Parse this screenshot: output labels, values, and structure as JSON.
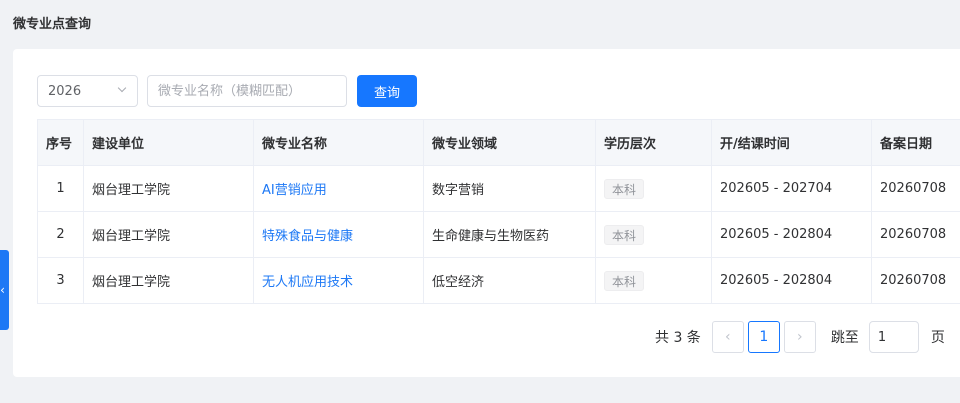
{
  "page": {
    "title": "微专业点查询"
  },
  "side_tab": {
    "icon": "chevron-left-icon",
    "glyph": "‹"
  },
  "filters": {
    "year": {
      "value": "2026"
    },
    "name": {
      "placeholder": "微专业名称（模糊匹配）",
      "value": ""
    },
    "query_label": "查询"
  },
  "table": {
    "columns": [
      "序号",
      "建设单位",
      "微专业名称",
      "微专业领域",
      "学历层次",
      "开/结课时间",
      "备案日期"
    ],
    "rows": [
      {
        "index": "1",
        "unit": "烟台理工学院",
        "name": "AI营销应用",
        "field": "数字营销",
        "level": "本科",
        "period": "202605 - 202704",
        "record_date": "20260708"
      },
      {
        "index": "2",
        "unit": "烟台理工学院",
        "name": "特殊食品与健康",
        "field": "生命健康与生物医药",
        "level": "本科",
        "period": "202605 - 202804",
        "record_date": "20260708"
      },
      {
        "index": "3",
        "unit": "烟台理工学院",
        "name": "无人机应用技术",
        "field": "低空经济",
        "level": "本科",
        "period": "202605 - 202804",
        "record_date": "20260708"
      }
    ]
  },
  "pagination": {
    "total": "共 3 条",
    "prev": "‹",
    "current": "1",
    "next": "›",
    "goto_label": "跳至",
    "goto_value": "1",
    "page_suffix": "页"
  },
  "colors": {
    "accent": "#1677ff",
    "link": "#1d78f5",
    "background": "#f0f2f5"
  }
}
